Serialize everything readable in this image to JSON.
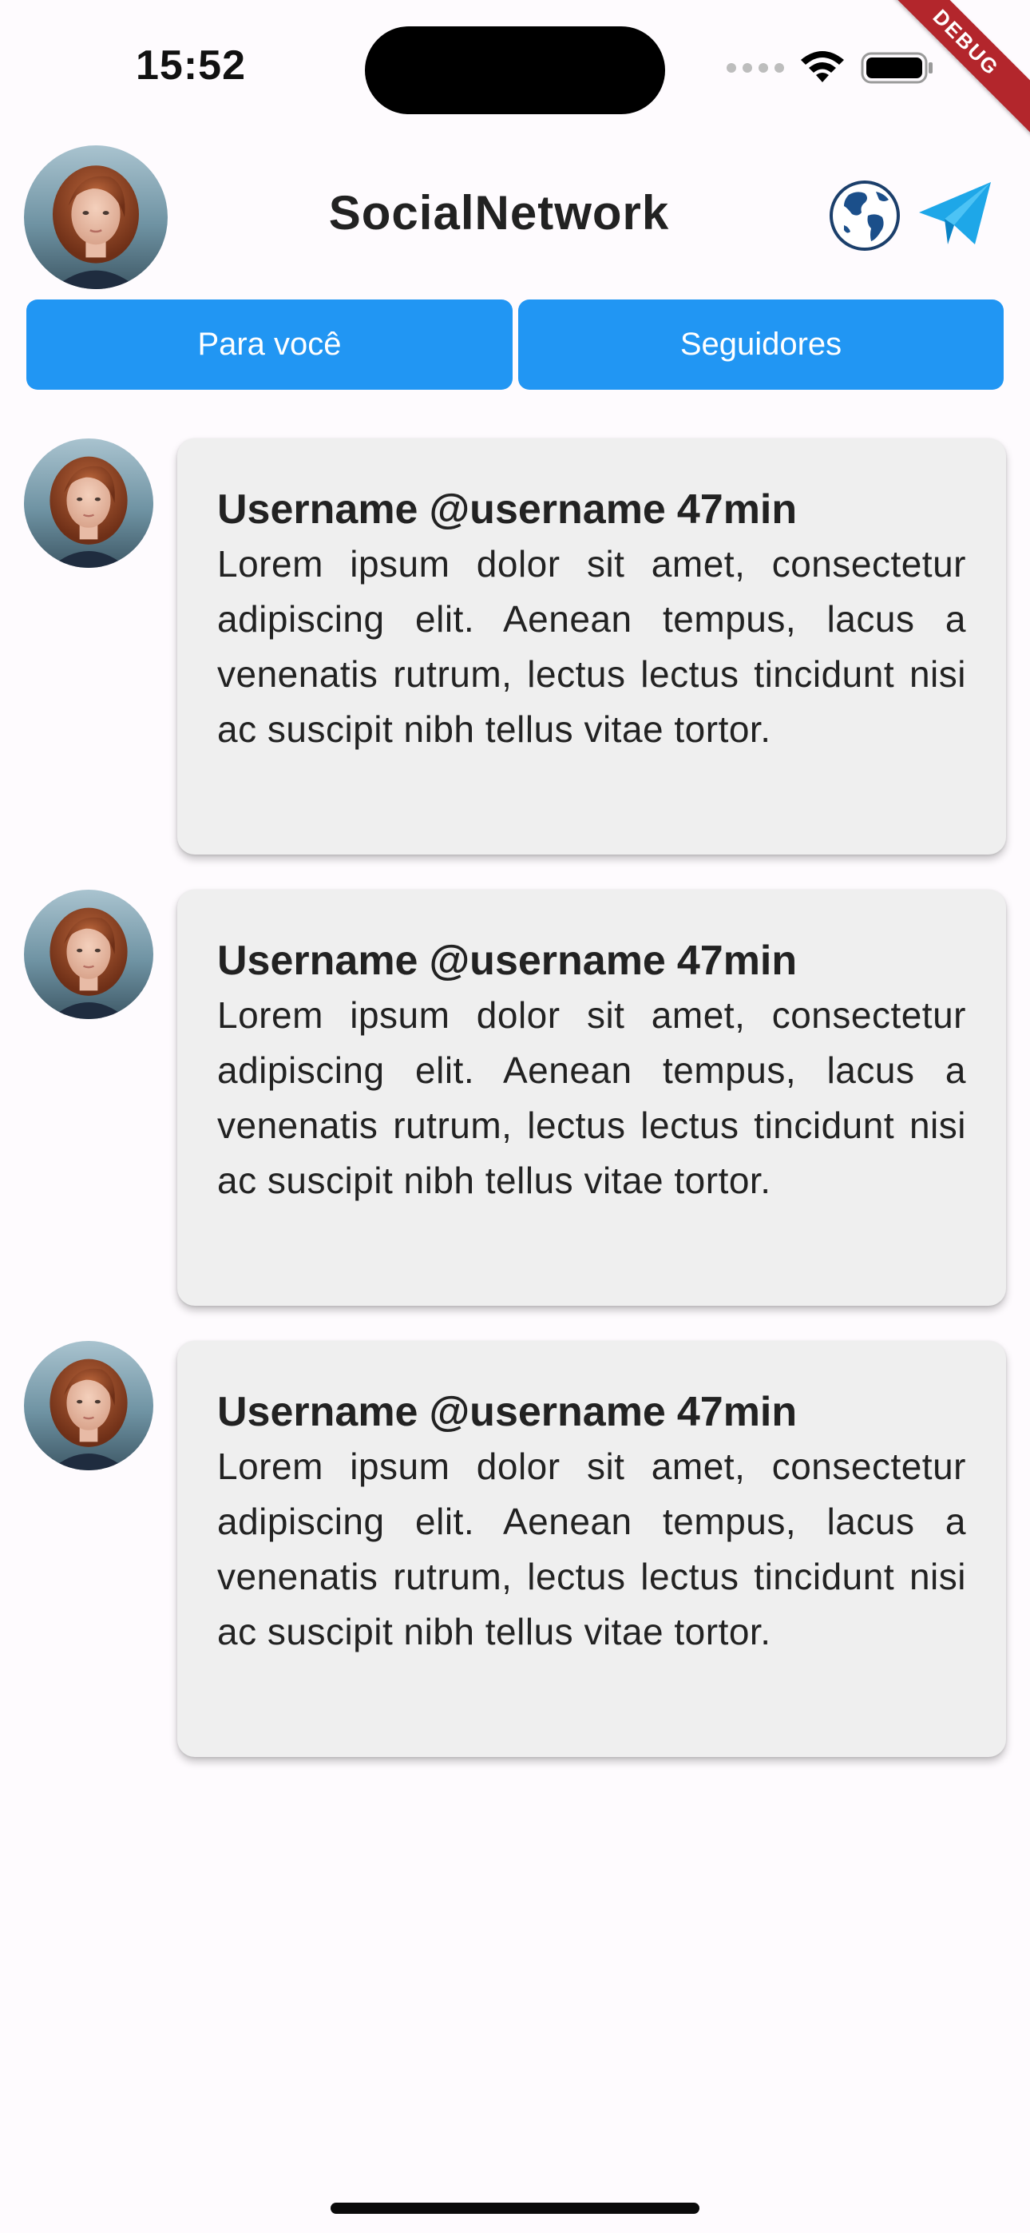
{
  "status_bar": {
    "time": "15:52"
  },
  "debug_banner": "DEBUG",
  "header": {
    "title": "SocialNetwork",
    "globe_icon": "globe-icon",
    "send_icon": "paper-plane-icon"
  },
  "tabs": [
    {
      "label": "Para você"
    },
    {
      "label": "Seguidores"
    }
  ],
  "colors": {
    "accent": "#2196f3",
    "card_background": "#efefef",
    "page_background": "#fefbfe"
  },
  "posts": [
    {
      "display_name": "Username",
      "handle": "@username",
      "time": "47min",
      "text": "Lorem ipsum dolor sit amet, consectetur adipiscing elit. Aenean tempus, lacus a venenatis rutrum, lectus lectus tincidunt nisi ac suscipit nibh tellus vitae tortor."
    },
    {
      "display_name": "Username",
      "handle": "@username",
      "time": "47min",
      "text": "Lorem ipsum dolor sit amet, consectetur adipiscing elit. Aenean tempus, lacus a venenatis rutrum, lectus lectus tincidunt nisi ac suscipit nibh tellus vitae tortor."
    },
    {
      "display_name": "Username",
      "handle": "@username",
      "time": "47min",
      "text": "Lorem ipsum dolor sit amet, consectetur adipiscing elit. Aenean tempus, lacus a venenatis rutrum, lectus lectus tincidunt nisi ac suscipit nibh tellus vitae tortor."
    }
  ]
}
